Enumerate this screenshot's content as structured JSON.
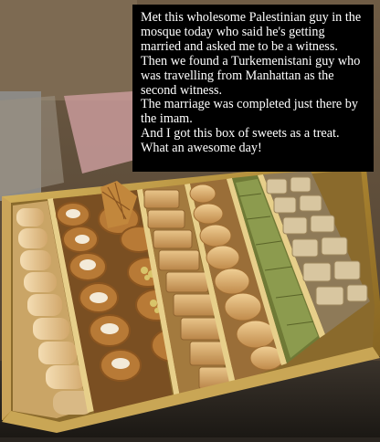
{
  "caption": {
    "lines": [
      "Met this wholesome Palestinian guy in the mosque today who said he's getting married and asked me to be a witness.",
      "Then we found a Turkemenistani guy who was travelling from Manhattan as the second witness.",
      "The marriage was completed just there by the imam.",
      "And I got this box of sweets as a treat.",
      "What an awesome day!"
    ]
  },
  "colors": {
    "caption_background": "#000000",
    "caption_text": "#ffffff",
    "box_gold": "#b8923e",
    "pastry": "#d9ac6a",
    "pistachio": "#8a9a4a"
  }
}
